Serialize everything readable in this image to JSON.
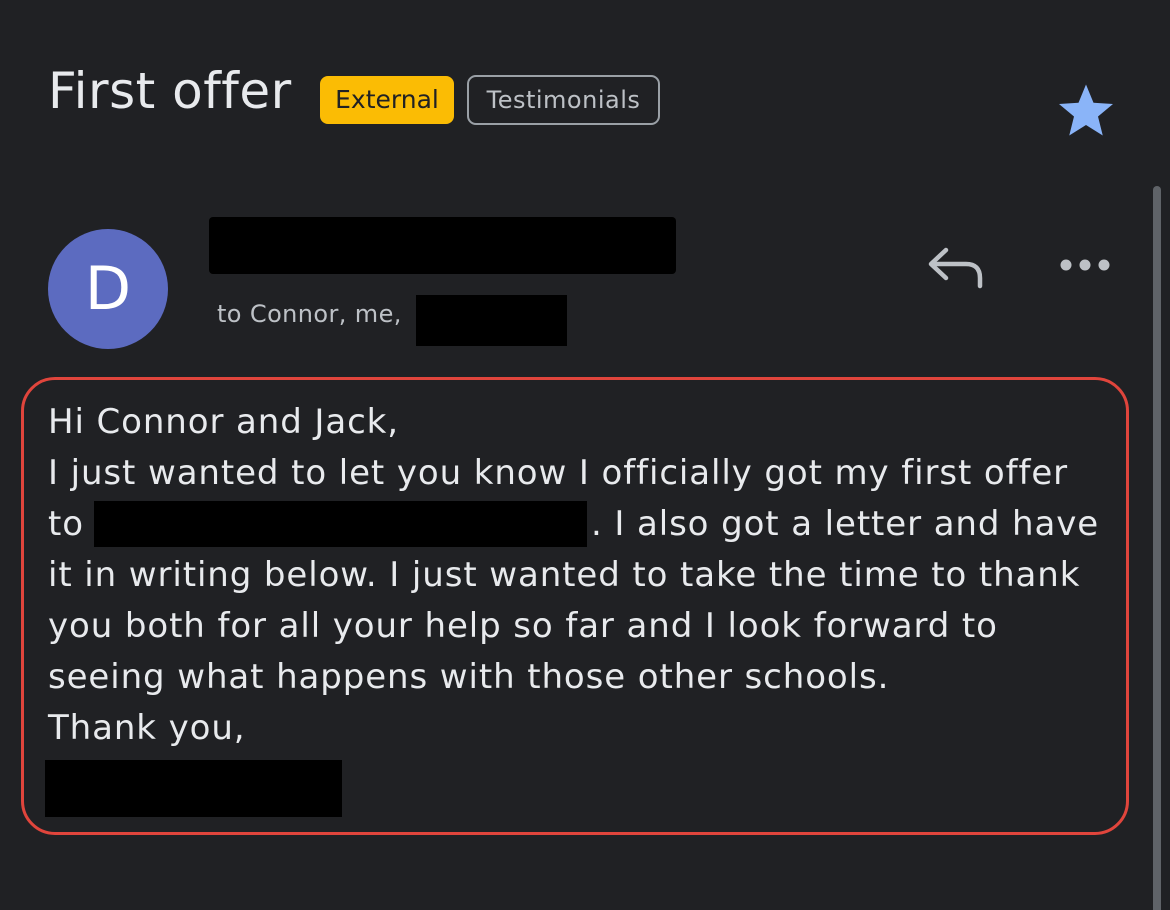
{
  "email": {
    "subject": "First offer",
    "labels": [
      {
        "text": "External",
        "color": "#fbbc04"
      },
      {
        "text": "Testimonials",
        "color": "#9aa0a6"
      }
    ],
    "starred": true,
    "star_color": "#8ab4f8",
    "avatar_letter": "D",
    "avatar_color": "#5c6bc0",
    "recipients_prefix": "to Connor, me,",
    "actions": {
      "reply_icon": "reply-icon",
      "more_icon": "more-options-icon"
    },
    "body": {
      "greeting": "Hi Connor and Jack,",
      "line1": "I just wanted to let you know I officially got my first offer",
      "line2_start": "to",
      "line2_end": ". I also got a letter and have",
      "line3": "it in writing below. I just wanted to take the time to thank",
      "line4": "you both for all your help so far and I look forward to",
      "line5": "seeing what happens with those other schools.",
      "closing": "Thank you,"
    },
    "highlight_color": "#e0453c"
  }
}
